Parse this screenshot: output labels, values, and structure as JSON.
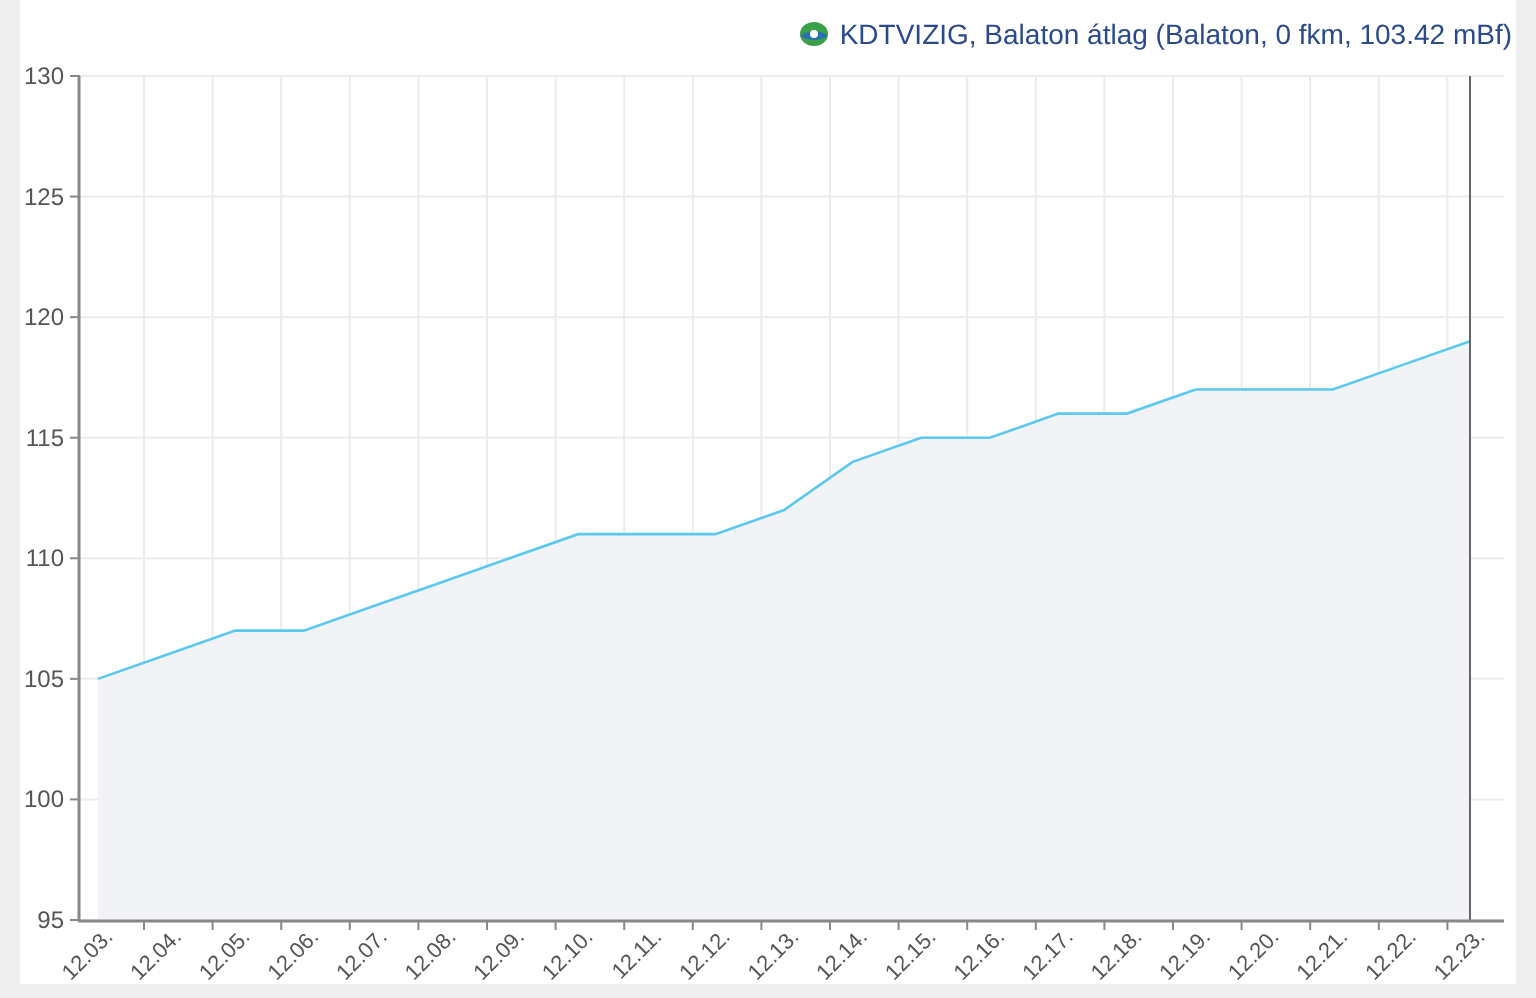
{
  "header": {
    "title": "KDTVIZIG, Balaton átlag (Balaton, 0 fkm, 103.42 mBf)"
  },
  "chart": {
    "chart_data": {
      "type": "area",
      "grid": true,
      "categories": [
        "12.03.",
        "12.04.",
        "12.05.",
        "12.06.",
        "12.07.",
        "12.08.",
        "12.09.",
        "12.10.",
        "12.11.",
        "12.12.",
        "12.13.",
        "12.14.",
        "12.15.",
        "12.16.",
        "12.17.",
        "12.18.",
        "12.19.",
        "12.20.",
        "12.21.",
        "12.22.",
        "12.23."
      ],
      "series": [
        {
          "color": "#5bc8ee",
          "values": [
            105,
            106,
            107,
            107,
            108,
            109,
            110,
            111,
            111,
            111,
            112,
            114,
            115,
            115,
            116,
            116,
            117,
            117,
            117,
            118,
            119
          ]
        }
      ],
      "ylim": [
        95,
        130
      ],
      "yticks": [
        95,
        100,
        105,
        110,
        115,
        120,
        125,
        130
      ],
      "ref_lines": [
        {
          "axis": "x",
          "value": "12.23."
        }
      ]
    }
  }
}
